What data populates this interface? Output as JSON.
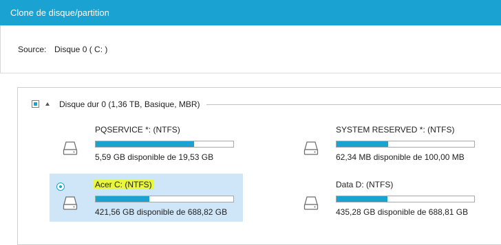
{
  "window": {
    "title": "Clone de disque/partition"
  },
  "source": {
    "label": "Source:",
    "value": "Disque 0 ( C: )"
  },
  "disk": {
    "title": "Disque dur 0 (1,36 TB, Basique, MBR)",
    "checked": true,
    "expanded": true
  },
  "partitions": [
    {
      "name": "PQSERVICE *: (NTFS)",
      "free_text": "5,59 GB disponible de 19,53 GB",
      "used_fraction": 0.714,
      "selected": false,
      "icon": "hard-drive-icon"
    },
    {
      "name": "SYSTEM RESERVED *: (NTFS)",
      "free_text": "62,34 MB disponible de 100,00 MB",
      "used_fraction": 0.377,
      "selected": false,
      "icon": "hard-drive-icon"
    },
    {
      "name": "Acer C: (NTFS)",
      "free_text": "421,56 GB disponible de 688,82 GB",
      "used_fraction": 0.388,
      "selected": true,
      "icon": "hard-drive-icon"
    },
    {
      "name": "Data D: (NTFS)",
      "free_text": "435,28 GB disponible de 688,81 GB",
      "used_fraction": 0.368,
      "selected": false,
      "icon": "hard-drive-icon"
    }
  ],
  "colors": {
    "accent": "#1aa2d3",
    "selection": "#cfe6f8",
    "highlight": "#e8f63c"
  }
}
